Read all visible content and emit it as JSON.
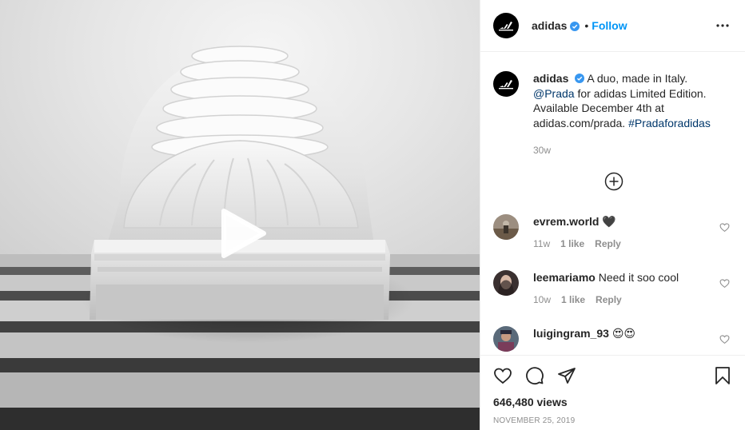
{
  "post": {
    "account": "adidas",
    "follow_label": "Follow",
    "dot": "•",
    "caption": {
      "username": "adidas",
      "text_1": "A duo, made in Italy.",
      "mention": "@Prada",
      "text_2": "for adidas Limited Edition. Available December 4th at adidas.com/prada.",
      "hashtag": "#Pradaforadidas",
      "time": "30w"
    },
    "comments": [
      {
        "username": "evrem.world",
        "text": "🖤",
        "time": "11w",
        "likes": "1 like",
        "reply": "Reply"
      },
      {
        "username": "leemariamo",
        "text": "Need it soo cool",
        "time": "10w",
        "likes": "1 like",
        "reply": "Reply"
      },
      {
        "username": "luigingram_93",
        "text": "😍😍",
        "time": "",
        "likes": "",
        "reply": ""
      }
    ],
    "views": "646,480 views",
    "date": "NOVEMBER 25, 2019"
  },
  "colors": {
    "link_blue": "#0095f6",
    "mention_blue": "#00376b",
    "muted_text": "#8e8e8e",
    "border": "#efefef",
    "text": "#262626"
  },
  "icons": {
    "play": "play-icon",
    "verified": "verified-badge-icon",
    "more": "more-options-icon",
    "load_more": "plus-circle-icon",
    "like": "heart-icon",
    "comment": "comment-icon",
    "share": "paper-plane-icon",
    "save": "bookmark-icon"
  }
}
